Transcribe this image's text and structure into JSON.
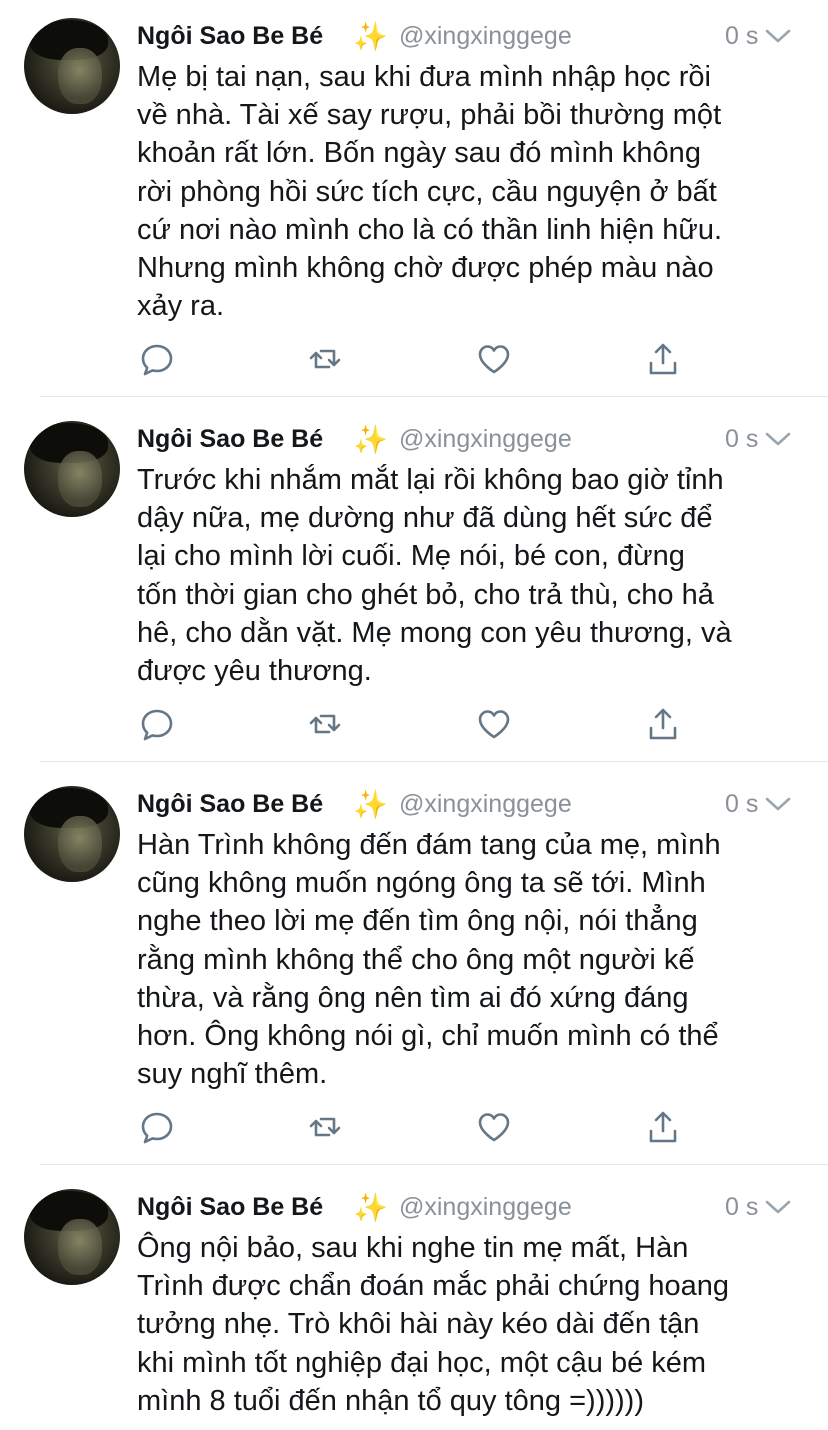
{
  "tweets": [
    {
      "display_name": "Ngôi Sao Be Bé",
      "handle": "@xingxinggege",
      "time": "0 s",
      "lines": [
        "Mẹ bị tai nạn, sau khi đưa mình nhập học rồi",
        "về nhà. Tài xế say rượu, phải bồi thường một",
        "khoản rất lớn. Bốn ngày sau đó mình không",
        "rời phòng hồi sức tích cực, cầu nguyện ở bất",
        "cứ nơi nào mình cho là có thần linh hiện hữu.",
        "Nhưng mình không chờ được phép màu nào",
        "xảy ra."
      ]
    },
    {
      "display_name": "Ngôi Sao Be Bé",
      "handle": "@xingxinggege",
      "time": "0 s",
      "lines": [
        "Trước khi nhắm mắt lại rồi không bao giờ tỉnh",
        "dậy nữa, mẹ dường như đã dùng hết sức để",
        "lại cho mình lời cuối. Mẹ nói, bé con, đừng",
        "tốn thời gian cho ghét bỏ, cho trả thù, cho hả",
        "hê, cho dằn vặt. Mẹ mong con yêu thương, và",
        "được yêu thương."
      ]
    },
    {
      "display_name": "Ngôi Sao Be Bé",
      "handle": "@xingxinggege",
      "time": "0 s",
      "lines": [
        "Hàn Trình không đến đám tang của mẹ, mình",
        "cũng không muốn ngóng ông ta sẽ tới. Mình",
        "nghe theo lời mẹ đến tìm ông nội, nói thẳng",
        "rằng mình không thể cho ông một người kế",
        "thừa, và rằng ông nên tìm ai đó xứng đáng",
        "hơn. Ông không nói gì, chỉ muốn mình có thể",
        "suy nghĩ thêm."
      ]
    },
    {
      "display_name": "Ngôi Sao Be Bé",
      "handle": "@xingxinggege",
      "time": "0 s",
      "lines": [
        "Ông nội bảo, sau khi nghe tin mẹ mất, Hàn",
        "Trình được chẩn đoán mắc phải chứng hoang",
        "tưởng nhẹ. Trò khôi hài này kéo dài đến tận",
        "khi mình tốt nghiệp đại học, một cậu bé kém",
        "mình 8 tuổi đến nhận tổ quy tông =))))))"
      ]
    }
  ],
  "icons": {
    "sparkle": "✨",
    "actions": [
      "reply-icon",
      "retweet-icon",
      "like-icon",
      "share-icon"
    ]
  },
  "colors": {
    "text": "#14171a",
    "secondary": "#8a9199",
    "icon": "#657786",
    "divider": "#e1e8ed",
    "sparkle": "#f5c542"
  }
}
